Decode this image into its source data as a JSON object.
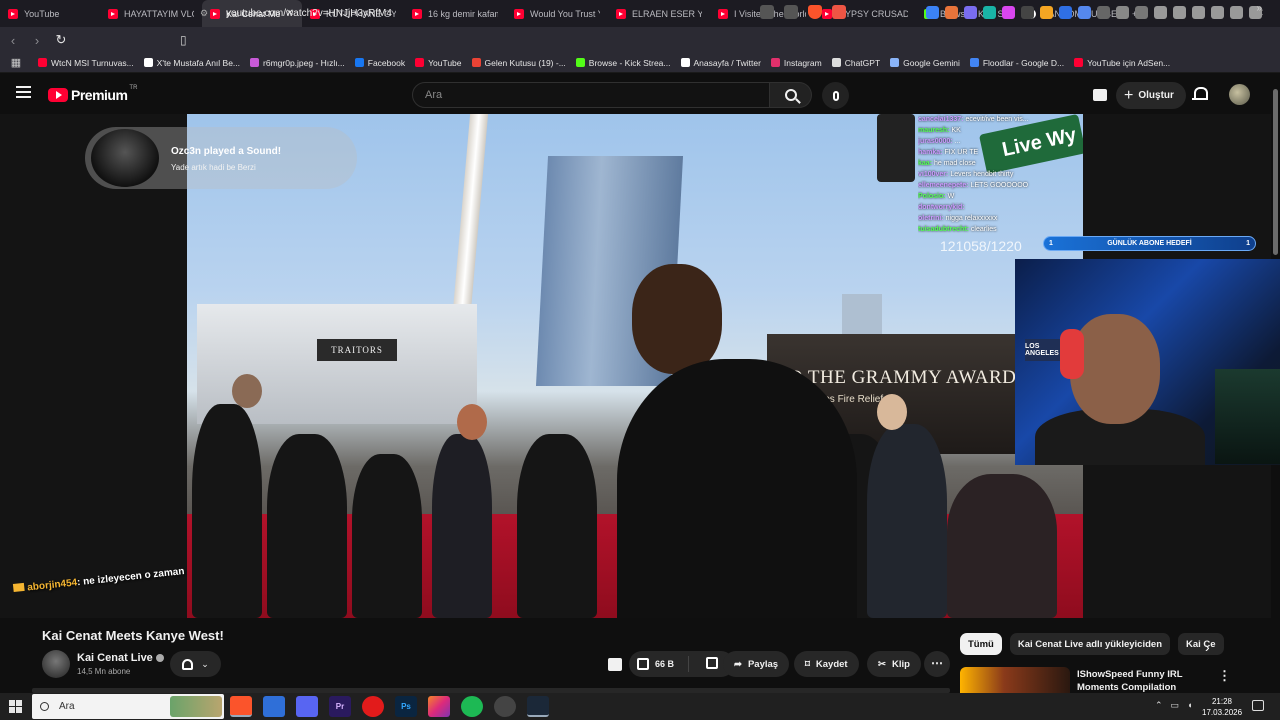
{
  "browser": {
    "tabs": [
      {
        "label": "YouTube",
        "kind": "yt"
      },
      {
        "label": "HAYATTAYIM VLOG",
        "kind": "yt"
      },
      {
        "label": "Kai Cenat Meets",
        "kind": "yt",
        "active": true
      },
      {
        "label": "KÜTÜPHANE OYUN",
        "kind": "yt"
      },
      {
        "label": "16 kg demir kafama",
        "kind": "yt"
      },
      {
        "label": "Would You Trust Yo",
        "kind": "yt"
      },
      {
        "label": "ELRAEN ESER YENİ",
        "kind": "yt"
      },
      {
        "label": "I Visited The World",
        "kind": "yt"
      },
      {
        "label": "GYPSY CRUSADER V",
        "kind": "yt"
      },
      {
        "label": "Browse - Kick Strea",
        "kind": "kick"
      },
      {
        "label": "RANDOM NUMBER",
        "kind": "rand"
      }
    ],
    "new_tab": "+",
    "url": "youtube.com/watch?v=HNJjH3yRfM4",
    "shield_badge": "4",
    "bookmarks": [
      {
        "label": "WtcN MSI Turnuvas...",
        "color": "#ff0033"
      },
      {
        "label": "X'te Mustafa Anıl Be...",
        "color": "#ffffff"
      },
      {
        "label": "r6mgr0p.jpeg - Hızlı...",
        "color": "#c85ad8"
      },
      {
        "label": "Facebook",
        "color": "#1877f2"
      },
      {
        "label": "YouTube",
        "color": "#ff0033"
      },
      {
        "label": "Gelen Kutusu (19) -...",
        "color": "#ea4335"
      },
      {
        "label": "Browse - Kick Strea...",
        "color": "#53fc18"
      },
      {
        "label": "Anasayfa / Twitter",
        "color": "#ffffff"
      },
      {
        "label": "Instagram",
        "color": "#e1306c"
      },
      {
        "label": "ChatGPT",
        "color": "#dddddd"
      },
      {
        "label": "Google Gemini",
        "color": "#8ab4f8"
      },
      {
        "label": "Floodlar - Google D...",
        "color": "#4285f4"
      },
      {
        "label": "YouTube için AdSen...",
        "color": "#ff0033"
      }
    ]
  },
  "youtube": {
    "logo_text": "Premium",
    "logo_region": "TR",
    "search_placeholder": "Ara",
    "create_label": "Oluştur"
  },
  "overlay": {
    "sound_title": "Ozc3n played a Sound!",
    "sound_sub": "Yade artık hadi be Berzi",
    "viewer_counter": "121058/1220",
    "sub_goal_left": "1",
    "sub_goal_label": "GÜNLÜK ABONE HEDEFİ",
    "sub_goal_right": "1",
    "chat": [
      {
        "user": "cancelai1337:",
        "msg": "ecevit/ive been vis..."
      },
      {
        "user": "mauresh:",
        "msg": "KK"
      },
      {
        "user": "juras0000:",
        "msg": "..."
      },
      {
        "user": "hamka:",
        "msg": "FIX UR TE"
      },
      {
        "user": "kaa:",
        "msg": "he mad close"
      },
      {
        "user": "vi100ver:",
        "msg": "Levers hendbit thirty"
      },
      {
        "user": "ellemeenepete:",
        "msg": "LETS GOOOOOO"
      },
      {
        "user": "Polosio:",
        "msg": "W"
      },
      {
        "user": "dontworrykid:",
        "msg": ""
      },
      {
        "user": "oletrini:",
        "msg": "nigga relaxxxxxx"
      },
      {
        "user": "tuisadubtrecht:",
        "msg": "clearlies"
      }
    ],
    "street_sign": "Live Wy",
    "grammy_banner": "TO THE GRAMMY AWARD",
    "grammy_sub": "MusiCares Fire Relief",
    "traitors_sign": "TRAITORS",
    "cam_sign": "LOS ANGELES",
    "floating_user": "aborjin454",
    "floating_msg": ": ne izleyecen o zaman"
  },
  "video": {
    "title": "Kai Cenat Meets Kanye West!",
    "channel": "Kai Cenat Live",
    "subscribers": "14,5 Mn abone",
    "likes": "66 B",
    "share_label": "Paylaş",
    "save_label": "Kaydet",
    "clip_label": "Klip",
    "more_label": "⋯"
  },
  "sidebar": {
    "chips": [
      {
        "label": "Tümü",
        "active": true
      },
      {
        "label": "Kai Cenat Live adlı yükleyiciden"
      },
      {
        "label": "Kai Ce"
      }
    ],
    "rec_title": "IShowSpeed Funny IRL Moments Compilation"
  },
  "taskbar": {
    "search_label": "Ara",
    "time": "21:28",
    "date": "17.03.2026"
  },
  "colors": {
    "youtube_red": "#ff0033",
    "kick_green": "#53fc18",
    "goal_blue": "#1a72d8"
  }
}
